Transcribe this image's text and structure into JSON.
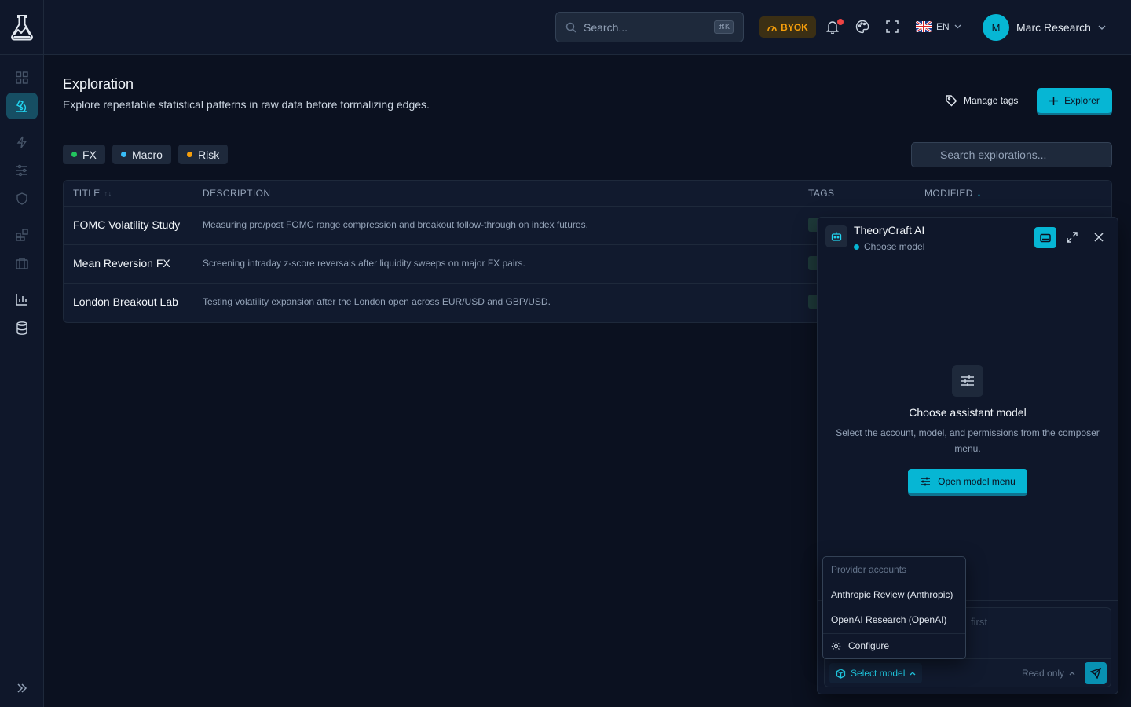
{
  "header": {
    "search_placeholder": "Search...",
    "search_shortcut": "⌘K",
    "byok_label": "BYOK",
    "language": "EN",
    "user_initial": "M",
    "user_name": "Marc Research"
  },
  "page": {
    "title": "Exploration",
    "subtitle": "Explore repeatable statistical patterns in raw data before formalizing edges.",
    "manage_tags_label": "Manage tags",
    "new_button_label": "Explorer",
    "search_placeholder": "Search explorations..."
  },
  "filter_chips": [
    {
      "label": "FX",
      "color": "#22c55e"
    },
    {
      "label": "Macro",
      "color": "#38bdf8"
    },
    {
      "label": "Risk",
      "color": "#f59e0b"
    }
  ],
  "table": {
    "columns": {
      "title": "TITLE",
      "description": "DESCRIPTION",
      "tags": "TAGS",
      "modified": "MODIFIED"
    },
    "rows": [
      {
        "title": "FOMC Volatility Study",
        "description": "Measuring pre/post FOMC range compression and breakout follow-through on index futures."
      },
      {
        "title": "Mean Reversion FX",
        "description": "Screening intraday z-score reversals after liquidity sweeps on major FX pairs."
      },
      {
        "title": "London Breakout Lab",
        "description": "Testing volatility expansion after the London open across EUR/USD and GBP/USD."
      }
    ]
  },
  "ai_panel": {
    "title": "TheoryCraft AI",
    "status": "Choose model",
    "empty_title": "Choose assistant model",
    "empty_desc": "Select the account, model, and permissions from the composer menu.",
    "open_menu_label": "Open model menu",
    "composer_placeholder": "first",
    "select_model_label": "Select model",
    "permission_label": "Read only"
  },
  "dropdown": {
    "header": "Provider accounts",
    "items": [
      "Anthropic Review (Anthropic)",
      "OpenAI Research (OpenAI)"
    ],
    "configure_label": "Configure"
  },
  "colors": {
    "accent": "#06b6d4",
    "background": "#0b1120",
    "surface": "#0f172a",
    "byok": "#f59e0b",
    "notification": "#ef4444"
  }
}
